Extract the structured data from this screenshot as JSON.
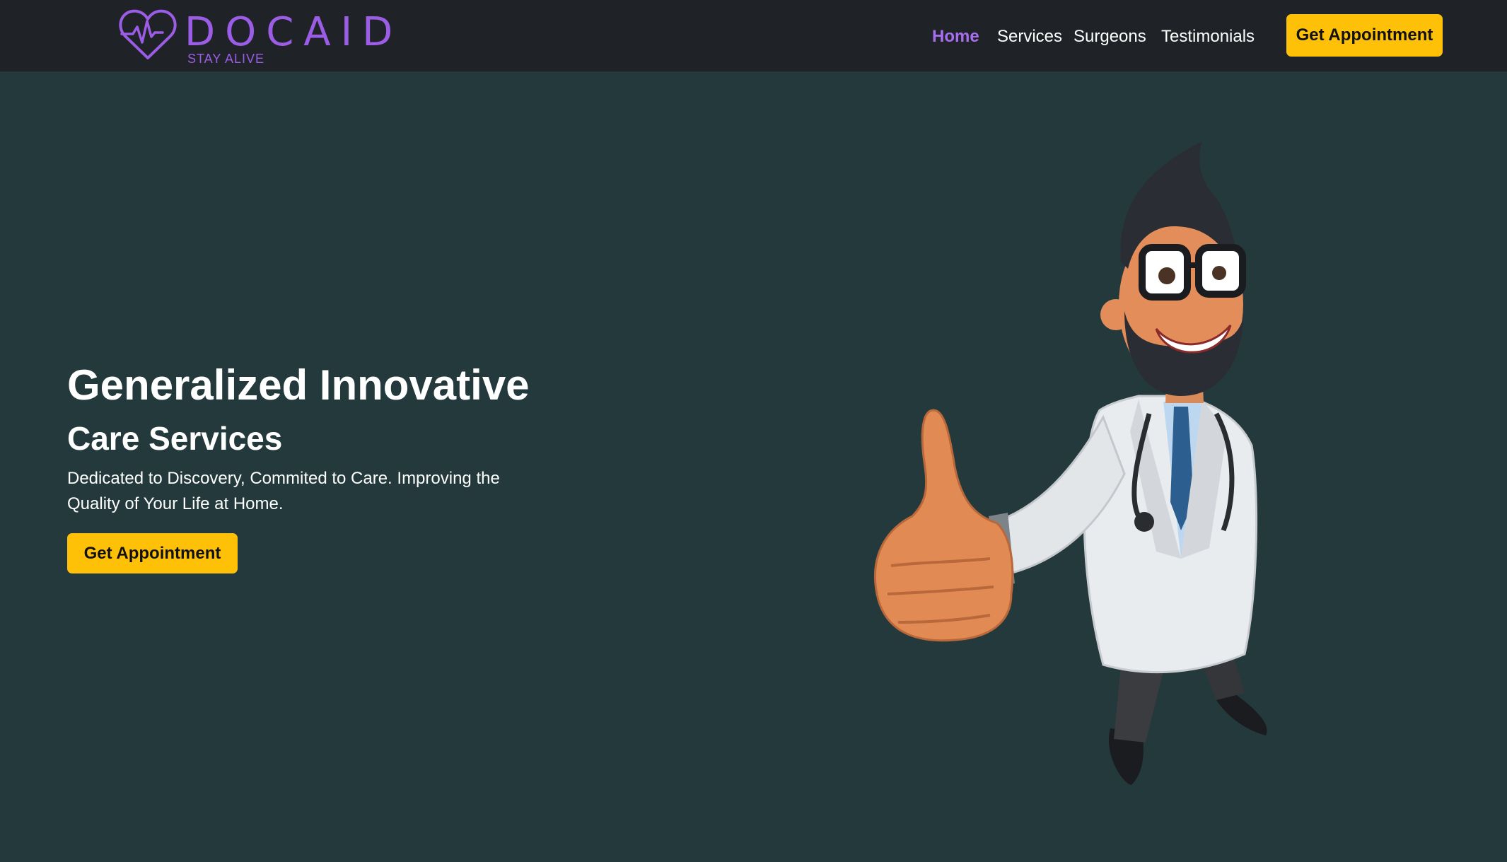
{
  "brand": {
    "name": "DOCAID",
    "tagline": "STAY ALIVE",
    "logo_icon": "heartbeat-heart-icon",
    "color": "#9b5de5"
  },
  "nav": {
    "links": [
      {
        "label": "Home",
        "active": true
      },
      {
        "label": "Services",
        "active": false
      },
      {
        "label": "Surgeons",
        "active": false
      },
      {
        "label": "Testimonials",
        "active": false
      }
    ],
    "cta_label": "Get Appointment"
  },
  "hero": {
    "title": "Generalized Innovative",
    "subtitle": "Care Services",
    "description": "Dedicated to Discovery, Commited to Care. Improving the Quality of Your Life at Home.",
    "cta_label": "Get Appointment",
    "illustration": "cartoon-doctor-thumbs-up"
  },
  "colors": {
    "nav_bg": "#1f2327",
    "hero_bg": "#23393b",
    "accent": "#ffc107",
    "active_link": "#a86ef0"
  }
}
